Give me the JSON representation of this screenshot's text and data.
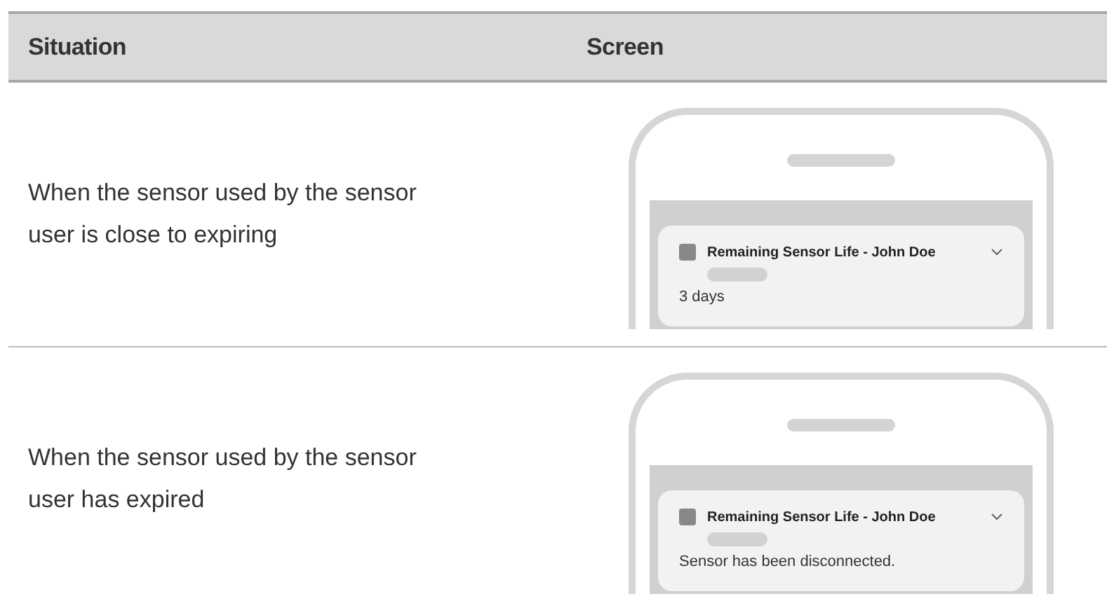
{
  "table": {
    "columns": [
      "Situation",
      "Screen"
    ],
    "rows": [
      {
        "situation": "When the sensor used by the sensor user is close to expiring",
        "notification": {
          "title": "Remaining Sensor Life - John Doe",
          "body": "3 days"
        }
      },
      {
        "situation": "When the sensor used by the sensor user has expired",
        "notification": {
          "title": "Remaining Sensor Life - John Doe",
          "body": "Sensor has been disconnected."
        }
      }
    ]
  }
}
